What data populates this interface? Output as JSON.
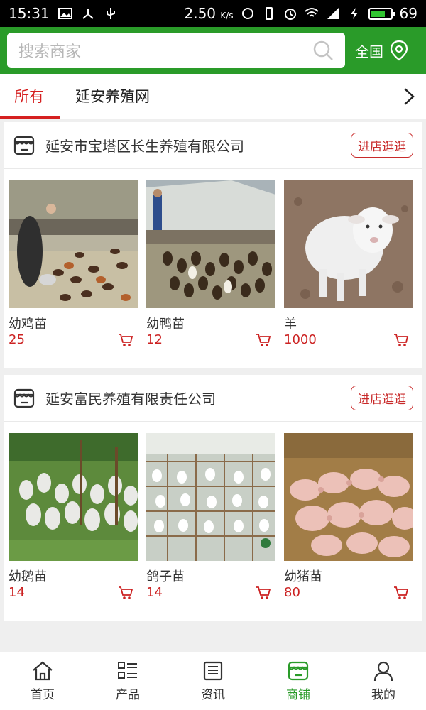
{
  "status": {
    "time": "15:31",
    "speed": "2.50",
    "speed_unit": "K/s",
    "battery": "69"
  },
  "search": {
    "placeholder": "搜索商家",
    "region_label": "全国"
  },
  "tabs": [
    {
      "label": "所有",
      "active": true
    },
    {
      "label": "延安养殖网",
      "active": false
    }
  ],
  "shops": [
    {
      "name": "延安市宝塔区长生养殖有限公司",
      "enter_label": "进店逛逛",
      "products": [
        {
          "name": "幼鸡苗",
          "price": "25"
        },
        {
          "name": "幼鸭苗",
          "price": "12"
        },
        {
          "name": "羊",
          "price": "1000"
        }
      ]
    },
    {
      "name": "延安富民养殖有限责任公司",
      "enter_label": "进店逛逛",
      "products": [
        {
          "name": "幼鹅苗",
          "price": "14"
        },
        {
          "name": "鸽子苗",
          "price": "14"
        },
        {
          "name": "幼猪苗",
          "price": "80"
        }
      ]
    }
  ],
  "nav": [
    {
      "label": "首页",
      "icon": "home-icon"
    },
    {
      "label": "产品",
      "icon": "product-list-icon"
    },
    {
      "label": "资讯",
      "icon": "news-icon"
    },
    {
      "label": "商铺",
      "icon": "store-icon",
      "active": true
    },
    {
      "label": "我的",
      "icon": "profile-icon"
    }
  ],
  "colors": {
    "brand_green": "#2a9b29",
    "accent_red": "#d52020"
  }
}
